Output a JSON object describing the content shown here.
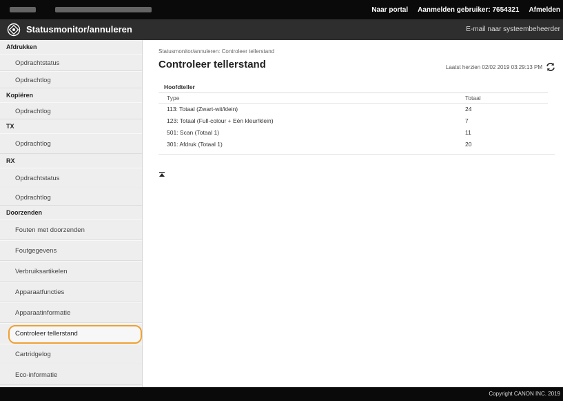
{
  "header": {
    "portal_link": "Naar portal",
    "logged_in_label": "Aanmelden gebruiker:",
    "user_id": "7654321",
    "logout_link": "Afmelden"
  },
  "titlebar": {
    "app_title": "Statusmonitor/annuleren",
    "mail_link": "E-mail naar systeembeheerder"
  },
  "sidebar": {
    "sections": [
      {
        "label": "Afdrukken",
        "items": [
          "Opdrachtstatus",
          "Opdrachtlog"
        ]
      },
      {
        "label": "Kopiëren",
        "items": [
          "Opdrachtlog"
        ]
      },
      {
        "label": "TX",
        "items": [
          "Opdrachtlog"
        ]
      },
      {
        "label": "RX",
        "items": [
          "Opdrachtstatus",
          "Opdrachtlog"
        ]
      },
      {
        "label": "Doorzenden",
        "items": [
          "Fouten met doorzenden"
        ]
      }
    ],
    "standalone": [
      "Foutgegevens",
      "Verbruiksartikelen",
      "Apparaatfuncties",
      "Apparaatinformatie",
      "Controleer tellerstand",
      "Cartridgelog",
      "Eco-informatie"
    ],
    "selected": "Controleer tellerstand"
  },
  "main": {
    "breadcrumb": "Statusmonitor/annuleren: Controleer tellerstand",
    "title": "Controleer tellerstand",
    "last_updated": "Laatst herzien 02/02 2019 03:29:13 PM",
    "counter": {
      "heading": "Hoofdteller",
      "columns": [
        "Type",
        "Totaal"
      ],
      "rows": [
        [
          "113: Totaal (Zwart-wit/klein)",
          "24"
        ],
        [
          "123: Totaal (Full-colour + Eén kleur/klein)",
          "7"
        ],
        [
          "501: Scan (Totaal 1)",
          "11"
        ],
        [
          "301: Afdruk (Totaal 1)",
          "20"
        ]
      ]
    }
  },
  "footer": {
    "copyright": "Copyright CANON INC. 2019"
  },
  "colors": {
    "topbar": "#0a0a0a",
    "titlebar": "#2e2e2e",
    "sidebar": "#eeeeee",
    "selected_outline": "#f0a030"
  }
}
